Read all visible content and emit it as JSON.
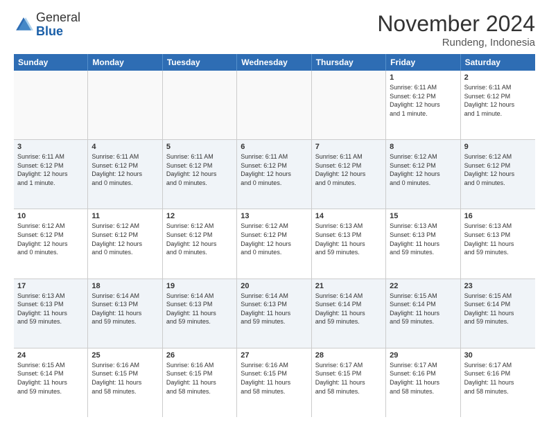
{
  "logo": {
    "general": "General",
    "blue": "Blue"
  },
  "header": {
    "month": "November 2024",
    "location": "Rundeng, Indonesia"
  },
  "weekdays": [
    "Sunday",
    "Monday",
    "Tuesday",
    "Wednesday",
    "Thursday",
    "Friday",
    "Saturday"
  ],
  "rows": [
    {
      "alt": false,
      "cells": [
        {
          "empty": true
        },
        {
          "empty": true
        },
        {
          "empty": true
        },
        {
          "empty": true
        },
        {
          "empty": true
        },
        {
          "day": "1",
          "info": "Sunrise: 6:11 AM\nSunset: 6:12 PM\nDaylight: 12 hours\nand 1 minute."
        },
        {
          "day": "2",
          "info": "Sunrise: 6:11 AM\nSunset: 6:12 PM\nDaylight: 12 hours\nand 1 minute."
        }
      ]
    },
    {
      "alt": true,
      "cells": [
        {
          "day": "3",
          "info": "Sunrise: 6:11 AM\nSunset: 6:12 PM\nDaylight: 12 hours\nand 1 minute."
        },
        {
          "day": "4",
          "info": "Sunrise: 6:11 AM\nSunset: 6:12 PM\nDaylight: 12 hours\nand 0 minutes."
        },
        {
          "day": "5",
          "info": "Sunrise: 6:11 AM\nSunset: 6:12 PM\nDaylight: 12 hours\nand 0 minutes."
        },
        {
          "day": "6",
          "info": "Sunrise: 6:11 AM\nSunset: 6:12 PM\nDaylight: 12 hours\nand 0 minutes."
        },
        {
          "day": "7",
          "info": "Sunrise: 6:11 AM\nSunset: 6:12 PM\nDaylight: 12 hours\nand 0 minutes."
        },
        {
          "day": "8",
          "info": "Sunrise: 6:12 AM\nSunset: 6:12 PM\nDaylight: 12 hours\nand 0 minutes."
        },
        {
          "day": "9",
          "info": "Sunrise: 6:12 AM\nSunset: 6:12 PM\nDaylight: 12 hours\nand 0 minutes."
        }
      ]
    },
    {
      "alt": false,
      "cells": [
        {
          "day": "10",
          "info": "Sunrise: 6:12 AM\nSunset: 6:12 PM\nDaylight: 12 hours\nand 0 minutes."
        },
        {
          "day": "11",
          "info": "Sunrise: 6:12 AM\nSunset: 6:12 PM\nDaylight: 12 hours\nand 0 minutes."
        },
        {
          "day": "12",
          "info": "Sunrise: 6:12 AM\nSunset: 6:12 PM\nDaylight: 12 hours\nand 0 minutes."
        },
        {
          "day": "13",
          "info": "Sunrise: 6:12 AM\nSunset: 6:12 PM\nDaylight: 12 hours\nand 0 minutes."
        },
        {
          "day": "14",
          "info": "Sunrise: 6:13 AM\nSunset: 6:13 PM\nDaylight: 11 hours\nand 59 minutes."
        },
        {
          "day": "15",
          "info": "Sunrise: 6:13 AM\nSunset: 6:13 PM\nDaylight: 11 hours\nand 59 minutes."
        },
        {
          "day": "16",
          "info": "Sunrise: 6:13 AM\nSunset: 6:13 PM\nDaylight: 11 hours\nand 59 minutes."
        }
      ]
    },
    {
      "alt": true,
      "cells": [
        {
          "day": "17",
          "info": "Sunrise: 6:13 AM\nSunset: 6:13 PM\nDaylight: 11 hours\nand 59 minutes."
        },
        {
          "day": "18",
          "info": "Sunrise: 6:14 AM\nSunset: 6:13 PM\nDaylight: 11 hours\nand 59 minutes."
        },
        {
          "day": "19",
          "info": "Sunrise: 6:14 AM\nSunset: 6:13 PM\nDaylight: 11 hours\nand 59 minutes."
        },
        {
          "day": "20",
          "info": "Sunrise: 6:14 AM\nSunset: 6:13 PM\nDaylight: 11 hours\nand 59 minutes."
        },
        {
          "day": "21",
          "info": "Sunrise: 6:14 AM\nSunset: 6:14 PM\nDaylight: 11 hours\nand 59 minutes."
        },
        {
          "day": "22",
          "info": "Sunrise: 6:15 AM\nSunset: 6:14 PM\nDaylight: 11 hours\nand 59 minutes."
        },
        {
          "day": "23",
          "info": "Sunrise: 6:15 AM\nSunset: 6:14 PM\nDaylight: 11 hours\nand 59 minutes."
        }
      ]
    },
    {
      "alt": false,
      "cells": [
        {
          "day": "24",
          "info": "Sunrise: 6:15 AM\nSunset: 6:14 PM\nDaylight: 11 hours\nand 59 minutes."
        },
        {
          "day": "25",
          "info": "Sunrise: 6:16 AM\nSunset: 6:15 PM\nDaylight: 11 hours\nand 58 minutes."
        },
        {
          "day": "26",
          "info": "Sunrise: 6:16 AM\nSunset: 6:15 PM\nDaylight: 11 hours\nand 58 minutes."
        },
        {
          "day": "27",
          "info": "Sunrise: 6:16 AM\nSunset: 6:15 PM\nDaylight: 11 hours\nand 58 minutes."
        },
        {
          "day": "28",
          "info": "Sunrise: 6:17 AM\nSunset: 6:15 PM\nDaylight: 11 hours\nand 58 minutes."
        },
        {
          "day": "29",
          "info": "Sunrise: 6:17 AM\nSunset: 6:16 PM\nDaylight: 11 hours\nand 58 minutes."
        },
        {
          "day": "30",
          "info": "Sunrise: 6:17 AM\nSunset: 6:16 PM\nDaylight: 11 hours\nand 58 minutes."
        }
      ]
    }
  ]
}
